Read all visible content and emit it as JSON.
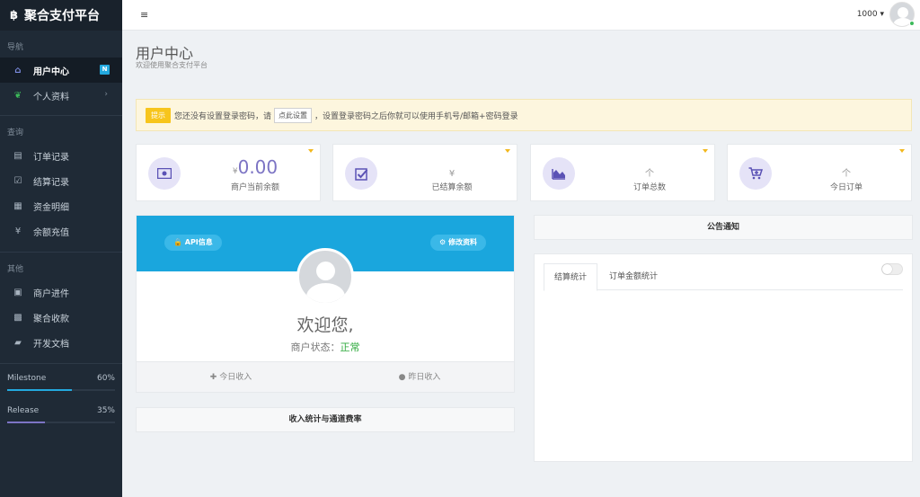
{
  "brand": {
    "logo": "฿",
    "name": "聚合支付平台"
  },
  "sidebar": {
    "sections": [
      {
        "title": "导航",
        "items": [
          {
            "label": "用户中心",
            "icon": "home-icon",
            "badge": "N",
            "active": true
          },
          {
            "label": "个人资料",
            "icon": "leaf-icon",
            "chevron": "›"
          }
        ]
      },
      {
        "title": "查询",
        "items": [
          {
            "label": "订单记录",
            "icon": "list-icon"
          },
          {
            "label": "结算记录",
            "icon": "check-icon"
          },
          {
            "label": "资金明细",
            "icon": "calendar-icon"
          },
          {
            "label": "余额充值",
            "icon": "yen-icon"
          }
        ]
      },
      {
        "title": "其他",
        "items": [
          {
            "label": "商户进件",
            "icon": "clipboard-icon"
          },
          {
            "label": "聚合收款",
            "icon": "qrcode-icon"
          },
          {
            "label": "开发文档",
            "icon": "book-icon"
          }
        ]
      }
    ],
    "progress": [
      {
        "label": "Milestone",
        "percent_text": "60%",
        "fraction": 0.6,
        "color": "#23a9df"
      },
      {
        "label": "Release",
        "percent_text": "35%",
        "fraction": 0.35,
        "color": "#7c74c4"
      }
    ]
  },
  "topbar": {
    "menu_icon": "≡",
    "user": "1000 ▾"
  },
  "page": {
    "title": "用户中心",
    "subtitle": "欢迎使用聚合支付平台"
  },
  "alert": {
    "tag": "提示",
    "text_before": "您还没有设置登录密码，请",
    "button": "点此设置",
    "text_after": "，设置登录密码之后你就可以使用手机号/邮箱+密码登录"
  },
  "stats": [
    {
      "value": "0.00",
      "currency": "¥",
      "label": "商户当前余额",
      "icon": "wallet-icon",
      "glyph": "💵"
    },
    {
      "value": "",
      "currency": "¥",
      "label": "已结算余额",
      "icon": "checkbox-icon",
      "glyph": "☑"
    },
    {
      "value": "个",
      "currency": "",
      "label": "订单总数",
      "icon": "area-chart-icon",
      "glyph": "◭"
    },
    {
      "value": "个",
      "currency": "",
      "label": "今日订单",
      "icon": "cart-plus-icon",
      "glyph": "🛒"
    }
  ],
  "profile": {
    "api_button": "🔒 API信息",
    "edit_button": "⚙ 修改资料",
    "welcome": "欢迎您,",
    "status_label": "商户状态：",
    "status_value": "正常",
    "today_income": "✚ 今日收入",
    "yesterday_income": "● 昨日收入"
  },
  "income_panel": {
    "title": "收入统计与通道费率"
  },
  "notice_panel": {
    "title": "公告通知"
  },
  "tabs": [
    {
      "label": "结算统计",
      "active": true
    },
    {
      "label": "订单金额统计",
      "active": false
    }
  ]
}
